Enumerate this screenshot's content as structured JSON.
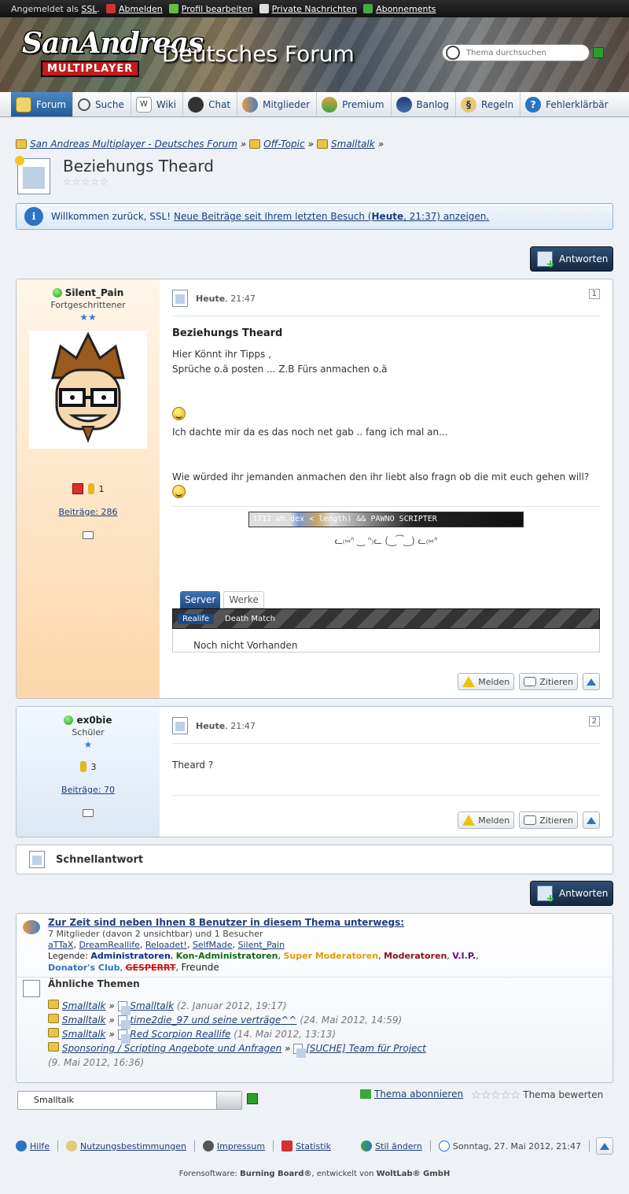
{
  "userbar": {
    "logged_in_prefix": "Angemeldet als",
    "username": "SSL",
    "logout": "Abmelden",
    "edit_profile": "Profil bearbeiten",
    "messages": "Private Nachrichten",
    "subscriptions": "Abonnements"
  },
  "header": {
    "logo_main": "SanAndreas",
    "logo_sub": "MULTIPLAYER",
    "forum_title": "Deutsches Forum",
    "search_placeholder": "Thema durchsuchen"
  },
  "nav": [
    {
      "label": "Forum",
      "icon": "folder-icon",
      "active": true
    },
    {
      "label": "Suche",
      "icon": "search-icon"
    },
    {
      "label": "Wiki",
      "icon": "wiki-icon"
    },
    {
      "label": "Chat",
      "icon": "chat-bubble-icon"
    },
    {
      "label": "Mitglieder",
      "icon": "members-icon"
    },
    {
      "label": "Premium",
      "icon": "premium-user-icon"
    },
    {
      "label": "Banlog",
      "icon": "police-icon"
    },
    {
      "label": "Regeln",
      "icon": "paragraph-icon"
    },
    {
      "label": "Fehlerklärbär",
      "icon": "help-icon"
    }
  ],
  "breadcrumb": [
    "San Andreas Multiplayer - Deutsches Forum",
    "Off-Topic",
    "Smalltalk"
  ],
  "thread": {
    "title": "Beziehungs Theard",
    "rating_stars": "☆☆☆☆☆"
  },
  "welcome": {
    "greeting": "Willkommen zurück, SSL!",
    "link_prefix": "Neue Beiträge seit Ihrem letzten Besuch (",
    "link_bold": "Heute",
    "link_suffix": ", 21:37) anzeigen."
  },
  "reply_button": "Antworten",
  "posts": [
    {
      "author": "Silent_Pain",
      "rank": "Fortgeschrittener",
      "rank_stars": "★★",
      "reputation": "1",
      "posts_label": "Beiträge: 286",
      "date_bold": "Heute",
      "time": ", 21:47",
      "number": "1",
      "title": "Beziehungs Theard",
      "lines": [
        "Hier Könnt ihr Tipps ,",
        "Sprüche o.ä posten ... Z.B Fürs anmachen o.ä",
        "Ich dachte mir da es das noch net gab .. fang ich mal an...",
        "Wie würded ihr jemanden anmachen den ihr liebt also fragn ob die mit euch gehen will?"
      ],
      "sig_banner": "1712 wh  dex < length) && PAWNO SCRIPTER",
      "sig_text": "ᓚ₍⑅ᐢ ‿ ᐢ₎ᓚ  (‿⁀‿)  ᓚ₍⑅ᐢ",
      "tabs": [
        "Server",
        "Werke"
      ],
      "subtabs": [
        "Realife",
        "Death Match"
      ],
      "tab_content": "Noch nicht Vorhanden"
    },
    {
      "author": "ex0bie",
      "rank": "Schüler",
      "rank_stars": "★",
      "reputation": "3",
      "posts_label": "Beiträge: 70",
      "date_bold": "Heute",
      "time": ", 21:47",
      "number": "2",
      "text": "Theard ?"
    }
  ],
  "post_actions": {
    "report": "Melden",
    "quote": "Zitieren"
  },
  "quick_reply": "Schnellantwort",
  "online": {
    "title": "Zur Zeit sind neben Ihnen 8 Benutzer in diesem Thema unterwegs:",
    "summary": "7 Mitglieder (davon 2 unsichtbar) und 1 Besucher",
    "users": [
      "aTTaX",
      "DreamReallife",
      "Reloadet!",
      "SelfMade",
      "Silent_Pain"
    ],
    "legend_label": "Legende:",
    "legend": [
      "Administratoren",
      "Kon-Administratoren",
      "Super Moderatoren",
      "Moderatoren",
      "V.I.P.",
      "Donator's Club",
      "GESPERRT",
      "Freunde"
    ]
  },
  "similar": {
    "title": "Ähnliche Themen",
    "items": [
      {
        "board": "Smalltalk",
        "thread": "Smalltalk",
        "date": "(2. Januar 2012, 19:17)"
      },
      {
        "board": "Smalltalk",
        "thread": "time2die_97 und seine verträge^^",
        "date": "(24. Mai 2012, 14:59)"
      },
      {
        "board": "Smalltalk",
        "thread": "Red Scorpion Reallife",
        "date": "(14. Mai 2012, 13:13)"
      },
      {
        "board": "Sponsoring / Scripting Angebote und Anfragen",
        "thread": "[SUCHE] Team für Project",
        "date": "(9. Mai 2012, 16:36)"
      }
    ]
  },
  "jump_select": "Smalltalk",
  "subscribe": "Thema abonnieren",
  "rate": "Thema bewerten",
  "footer": {
    "help": "Hilfe",
    "terms": "Nutzungsbestimmungen",
    "imprint": "Impressum",
    "stats": "Statistik",
    "style": "Stil ändern",
    "datetime": "Sonntag, 27. Mai 2012, 21:47",
    "software_prefix": "Forensoftware:",
    "software": "Burning Board®",
    "dev_prefix": ", entwickelt von",
    "dev": "WoltLab® GmbH"
  }
}
